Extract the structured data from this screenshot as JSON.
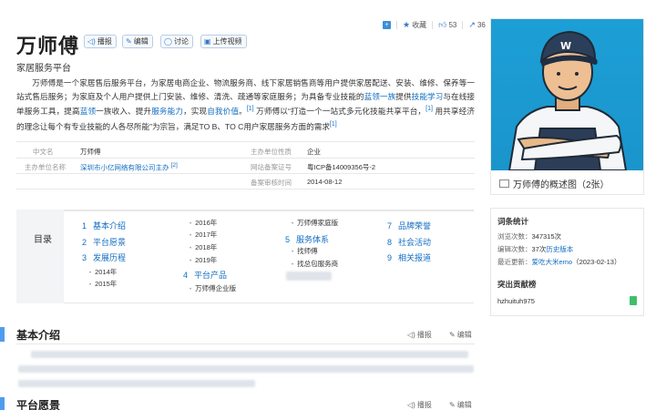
{
  "header": {
    "title": "万师傅",
    "subtitle": "家居服务平台",
    "buttons": [
      {
        "label": "播报",
        "icon": "speaker-icon"
      },
      {
        "label": "编辑",
        "icon": "pencil-icon"
      },
      {
        "label": "讨论",
        "icon": "chat-icon"
      },
      {
        "label": "上传视频",
        "icon": "video-icon"
      }
    ],
    "topbar": {
      "collect_label": "收藏",
      "like_count": "53",
      "share_count": "36"
    }
  },
  "summary": {
    "part1": "万师傅是一个家居售后服务平台，为家居电商企业、物流服务商、线下家居销售商等用户提供家居配送、安装、维修、保养等一站式售后服务；为家庭及个人用户提供上门安装、维修、清洗、疏通等家庭服务；为具备专业技能的",
    "link1": "蓝领一族",
    "part2": "提供",
    "link2": "技能学习",
    "part3": "与在线接单服务工具，提高",
    "link3": "蓝领",
    "part4": "一族收入、提升",
    "link4": "服务能力",
    "part5": "，实现",
    "link5": "自我价值",
    "part6": "。",
    "ref1": "[1]",
    "part7": " 万师傅以“打造一个一站式多元化技能共享平台，",
    "ref2": "[1]",
    "part8": " 用共享经济的理念让每个有专业技能的人各尽所能”为宗旨，满足TO B、TO C用户家居服务方面的需求",
    "ref3": "[1]"
  },
  "basic_info": {
    "left": [
      {
        "label": "中文名",
        "value": "万师傅"
      },
      {
        "label": "主办单位名称",
        "value": "深圳市小亿网络有限公司主办",
        "ref": "[2]"
      }
    ],
    "right": [
      {
        "label": "主办单位性质",
        "value": "企业"
      },
      {
        "label": "网站备案证号",
        "value": "粤ICP备14009356号-2"
      },
      {
        "label": "备案审核时间",
        "value": "2014-08-12"
      }
    ]
  },
  "toc": {
    "label": "目录",
    "col1": [
      {
        "num": "1",
        "text": "基本介绍"
      },
      {
        "num": "2",
        "text": "平台愿景"
      },
      {
        "num": "3",
        "text": "发展历程"
      }
    ],
    "col1_sub": [
      "2014年",
      "2015年"
    ],
    "col2_sub": [
      "2016年",
      "2017年",
      "2018年",
      "2019年"
    ],
    "col2_main": {
      "num": "4",
      "text": "平台产品"
    },
    "col2_sub2": [
      "万师傅企业版"
    ],
    "col3_sub": [
      "万师傅家庭版"
    ],
    "col3_main": {
      "num": "5",
      "text": "服务体系"
    },
    "col3_sub2": [
      "找师傅",
      "找总包服务商"
    ],
    "col4": [
      {
        "num": "7",
        "text": "品牌荣誉"
      },
      {
        "num": "8",
        "text": "社会活动"
      },
      {
        "num": "9",
        "text": "相关报道"
      }
    ]
  },
  "picture": {
    "caption": "万师傅的概述图（2张）"
  },
  "stats": {
    "heading": "词条统计",
    "views_label": "浏览次数：",
    "views_value": "347315次",
    "edits_label": "编辑次数：",
    "edits_value": "37次",
    "edits_link": "历史版本",
    "updated_label": "最近更新：",
    "updated_user": "爱吃大米emo",
    "updated_date": "（2023-02-13）",
    "contrib_heading": "突出贡献榜",
    "contrib_user": "hzhuituh975"
  },
  "sections": [
    {
      "title": "基本介绍",
      "report": "播报",
      "edit": "编辑"
    },
    {
      "title": "平台愿景",
      "report": "播报",
      "edit": "编辑"
    }
  ],
  "colors": {
    "link": "#136ec2",
    "accent": "#4f9cee",
    "picture_bg": "#1c9fd6"
  }
}
